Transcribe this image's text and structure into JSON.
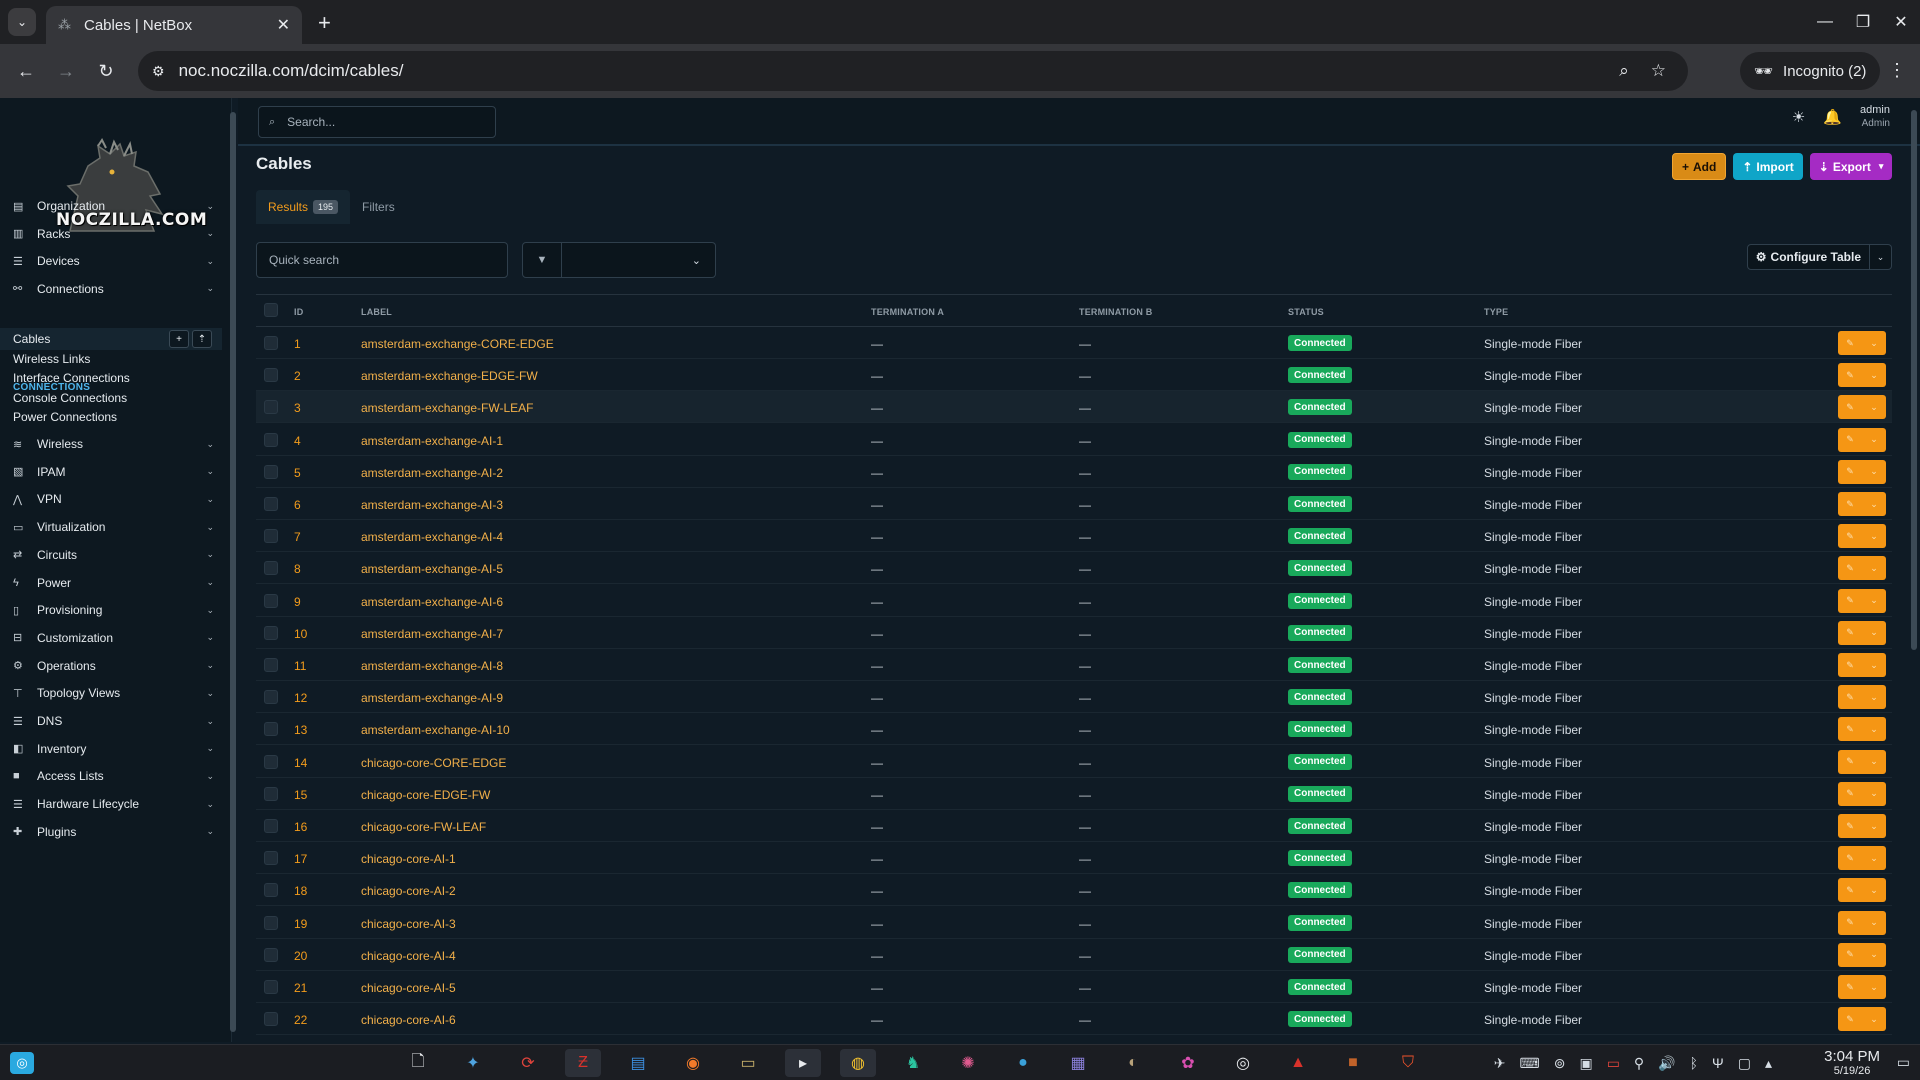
{
  "browser": {
    "tab_title": "Cables | NetBox",
    "url": "noc.noczilla.com/dcim/cables/",
    "incognito_label": "Incognito (2)"
  },
  "sidebar": {
    "logo_text": "NOCZILLA.COM",
    "sections_top": [
      {
        "label": "Organization",
        "icon": "building-icon"
      },
      {
        "label": "Racks",
        "icon": "rack-icon"
      },
      {
        "label": "Devices",
        "icon": "server-icon"
      },
      {
        "label": "Connections",
        "icon": "ethernet-icon"
      }
    ],
    "connections_heading": "CONNECTIONS",
    "connections_items": [
      "Cables",
      "Wireless Links",
      "Interface Connections",
      "Console Connections",
      "Power Connections"
    ],
    "sections_bottom": [
      {
        "label": "Wireless",
        "icon": "wifi-icon"
      },
      {
        "label": "IPAM",
        "icon": "counter-icon"
      },
      {
        "label": "VPN",
        "icon": "tunnel-icon"
      },
      {
        "label": "Virtualization",
        "icon": "monitor-icon"
      },
      {
        "label": "Circuits",
        "icon": "transit-icon"
      },
      {
        "label": "Power",
        "icon": "lightning-icon"
      },
      {
        "label": "Provisioning",
        "icon": "file-icon"
      },
      {
        "label": "Customization",
        "icon": "toolbox-icon"
      },
      {
        "label": "Operations",
        "icon": "cogs-icon"
      },
      {
        "label": "Topology Views",
        "icon": "sitemap-icon"
      },
      {
        "label": "DNS",
        "icon": "dns-icon"
      },
      {
        "label": "Inventory",
        "icon": "inventory-icon"
      },
      {
        "label": "Access Lists",
        "icon": "lock-icon"
      },
      {
        "label": "Hardware Lifecycle",
        "icon": "lifecycle-icon"
      },
      {
        "label": "Plugins",
        "icon": "puzzle-icon"
      }
    ]
  },
  "topbar": {
    "search_placeholder": "Search...",
    "user_name": "admin",
    "user_role": "Admin"
  },
  "page": {
    "title": "Cables",
    "add_label": "Add",
    "import_label": "Import",
    "export_label": "Export",
    "tab_results": "Results",
    "results_count": "195",
    "tab_filters": "Filters",
    "quick_search_placeholder": "Quick search",
    "configure_table_label": "Configure Table"
  },
  "table": {
    "columns": [
      "ID",
      "LABEL",
      "TERMINATION A",
      "TERMINATION B",
      "STATUS",
      "TYPE"
    ],
    "rows": [
      {
        "id": "1",
        "label": "amsterdam-exchange-CORE-EDGE",
        "ta": "—",
        "tb": "—",
        "status": "Connected",
        "type": "Single-mode Fiber"
      },
      {
        "id": "2",
        "label": "amsterdam-exchange-EDGE-FW",
        "ta": "—",
        "tb": "—",
        "status": "Connected",
        "type": "Single-mode Fiber"
      },
      {
        "id": "3",
        "label": "amsterdam-exchange-FW-LEAF",
        "ta": "—",
        "tb": "—",
        "status": "Connected",
        "type": "Single-mode Fiber"
      },
      {
        "id": "4",
        "label": "amsterdam-exchange-AI-1",
        "ta": "—",
        "tb": "—",
        "status": "Connected",
        "type": "Single-mode Fiber"
      },
      {
        "id": "5",
        "label": "amsterdam-exchange-AI-2",
        "ta": "—",
        "tb": "—",
        "status": "Connected",
        "type": "Single-mode Fiber"
      },
      {
        "id": "6",
        "label": "amsterdam-exchange-AI-3",
        "ta": "—",
        "tb": "—",
        "status": "Connected",
        "type": "Single-mode Fiber"
      },
      {
        "id": "7",
        "label": "amsterdam-exchange-AI-4",
        "ta": "—",
        "tb": "—",
        "status": "Connected",
        "type": "Single-mode Fiber"
      },
      {
        "id": "8",
        "label": "amsterdam-exchange-AI-5",
        "ta": "—",
        "tb": "—",
        "status": "Connected",
        "type": "Single-mode Fiber"
      },
      {
        "id": "9",
        "label": "amsterdam-exchange-AI-6",
        "ta": "—",
        "tb": "—",
        "status": "Connected",
        "type": "Single-mode Fiber"
      },
      {
        "id": "10",
        "label": "amsterdam-exchange-AI-7",
        "ta": "—",
        "tb": "—",
        "status": "Connected",
        "type": "Single-mode Fiber"
      },
      {
        "id": "11",
        "label": "amsterdam-exchange-AI-8",
        "ta": "—",
        "tb": "—",
        "status": "Connected",
        "type": "Single-mode Fiber"
      },
      {
        "id": "12",
        "label": "amsterdam-exchange-AI-9",
        "ta": "—",
        "tb": "—",
        "status": "Connected",
        "type": "Single-mode Fiber"
      },
      {
        "id": "13",
        "label": "amsterdam-exchange-AI-10",
        "ta": "—",
        "tb": "—",
        "status": "Connected",
        "type": "Single-mode Fiber"
      },
      {
        "id": "14",
        "label": "chicago-core-CORE-EDGE",
        "ta": "—",
        "tb": "—",
        "status": "Connected",
        "type": "Single-mode Fiber"
      },
      {
        "id": "15",
        "label": "chicago-core-EDGE-FW",
        "ta": "—",
        "tb": "—",
        "status": "Connected",
        "type": "Single-mode Fiber"
      },
      {
        "id": "16",
        "label": "chicago-core-FW-LEAF",
        "ta": "—",
        "tb": "—",
        "status": "Connected",
        "type": "Single-mode Fiber"
      },
      {
        "id": "17",
        "label": "chicago-core-AI-1",
        "ta": "—",
        "tb": "—",
        "status": "Connected",
        "type": "Single-mode Fiber"
      },
      {
        "id": "18",
        "label": "chicago-core-AI-2",
        "ta": "—",
        "tb": "—",
        "status": "Connected",
        "type": "Single-mode Fiber"
      },
      {
        "id": "19",
        "label": "chicago-core-AI-3",
        "ta": "—",
        "tb": "—",
        "status": "Connected",
        "type": "Single-mode Fiber"
      },
      {
        "id": "20",
        "label": "chicago-core-AI-4",
        "ta": "—",
        "tb": "—",
        "status": "Connected",
        "type": "Single-mode Fiber"
      },
      {
        "id": "21",
        "label": "chicago-core-AI-5",
        "ta": "—",
        "tb": "—",
        "status": "Connected",
        "type": "Single-mode Fiber"
      },
      {
        "id": "22",
        "label": "chicago-core-AI-6",
        "ta": "—",
        "tb": "—",
        "status": "Connected",
        "type": "Single-mode Fiber"
      }
    ]
  },
  "taskbar": {
    "time": "3:04 PM",
    "date": "5/19/26"
  },
  "colors": {
    "accent_orange": "#f39c1c",
    "status_connected": "#19a95b",
    "import_button": "#0fa5c8",
    "export_button": "#a52bc4"
  }
}
